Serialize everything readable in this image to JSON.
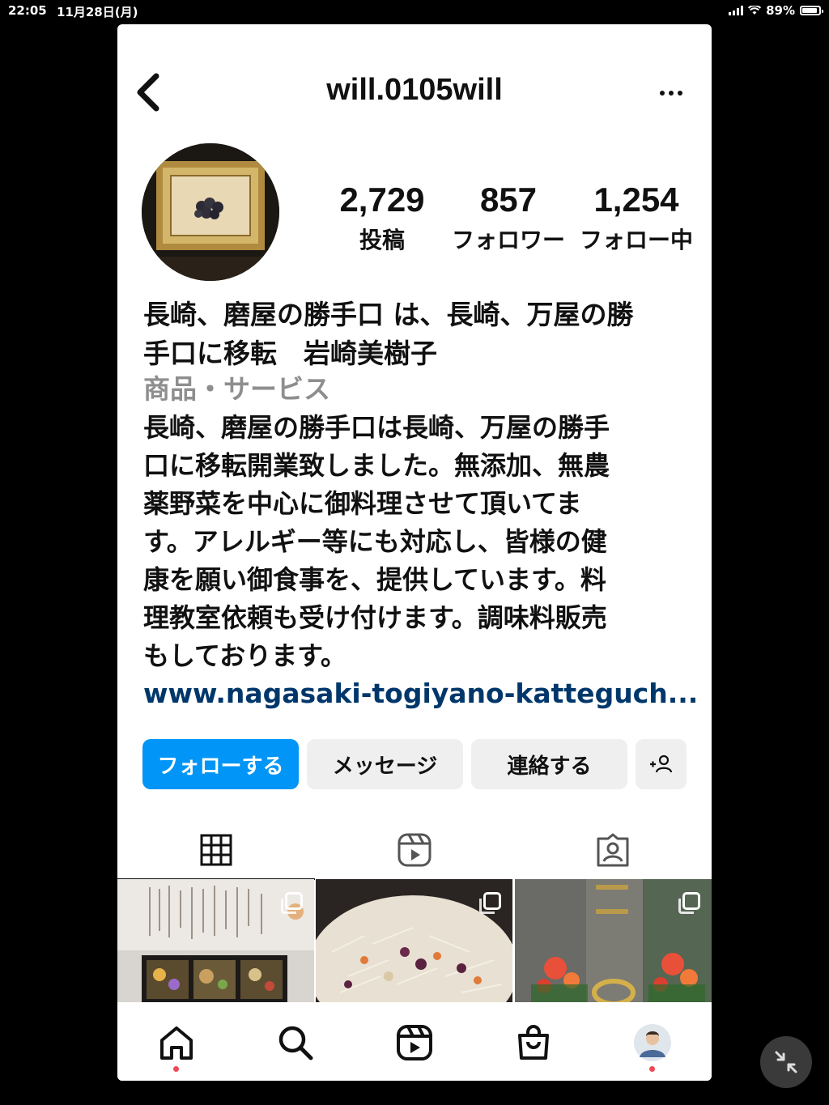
{
  "status_bar": {
    "time": "22:05",
    "date": "11月28日(月)",
    "battery": "89%"
  },
  "header": {
    "username": "will.0105will"
  },
  "stats": [
    {
      "value": "2,729",
      "label": "投稿"
    },
    {
      "value": "857",
      "label": "フォロワー"
    },
    {
      "value": "1,254",
      "label": "フォロー中"
    }
  ],
  "bio": {
    "name_line1": "長崎、磨屋の勝手口 は、長崎、万屋の勝",
    "name_line2": "手口に移転　岩崎美樹子",
    "category": "商品・サービス",
    "description_lines": [
      "長崎、磨屋の勝手口は長崎、万屋の勝手",
      "口に移転開業致しました。無添加、無農",
      "薬野菜を中心に御料理させて頂いてま",
      "す。アレルギー等にも対応し、皆様の健",
      "康を願い御食事を、提供しています。料",
      "理教室依頼も受け付けます。調味料販売",
      "もしております。"
    ],
    "link": "www.nagasaki-togiyano-katteguch..."
  },
  "buttons": {
    "follow": "フォローする",
    "message": "メッセージ",
    "contact": "連絡する",
    "suggest_icon": "add-person-icon"
  },
  "tabs": [
    {
      "icon": "grid-icon",
      "active": true
    },
    {
      "icon": "reels-icon",
      "active": false
    },
    {
      "icon": "tagged-icon",
      "active": false
    }
  ],
  "grid_posts": [
    {
      "image": "handwritten-letter-with-bento-box",
      "multi": true
    },
    {
      "image": "rice-dish-with-vegetables",
      "multi": true
    },
    {
      "image": "gravestone-with-flowers",
      "multi": true
    }
  ],
  "bottom_nav": [
    {
      "icon": "home-icon",
      "notification": true
    },
    {
      "icon": "search-icon",
      "notification": false
    },
    {
      "icon": "reels-icon",
      "notification": false
    },
    {
      "icon": "shop-icon",
      "notification": false
    },
    {
      "icon": "profile-avatar",
      "notification": true
    }
  ],
  "colors": {
    "accent": "#0095f6",
    "link": "#00376b",
    "secondary": "#8e8e8e",
    "notification": "#ed4956"
  }
}
